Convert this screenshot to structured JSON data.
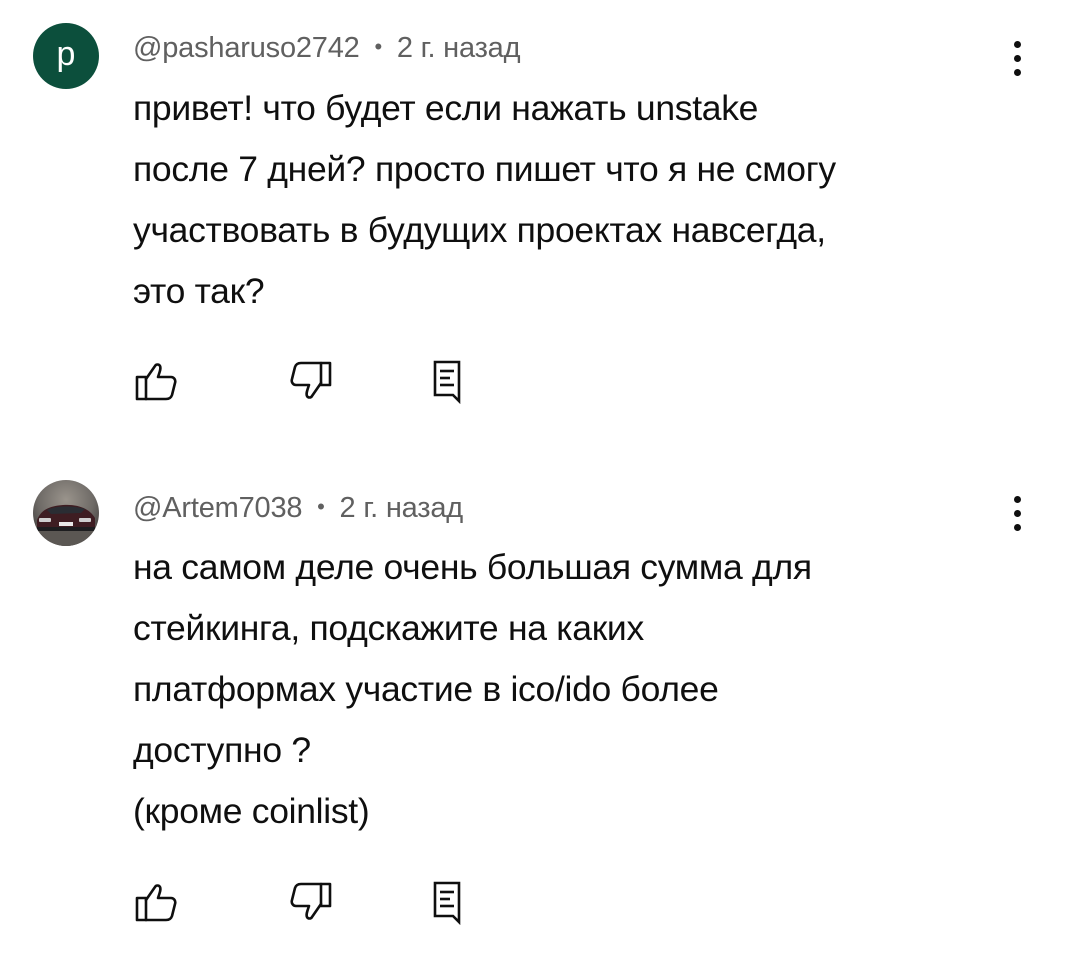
{
  "comments": [
    {
      "avatar_letter": "p",
      "avatar_color": "#0c4f3c",
      "author": "@pasharuso2742",
      "separator": "•",
      "time": "2 г. назад",
      "text": "привет! что будет если нажать unstake\nпосле 7 дней? просто пишет что я не смогу\nучаствовать  в будущих проектах навсегда,\nэто так?",
      "icons": {
        "like": "thumbs-up-icon",
        "dislike": "thumbs-down-icon",
        "reply": "reply-icon",
        "menu": "more-vert-icon"
      }
    },
    {
      "avatar_image": "car-photo",
      "author": "@Artem7038",
      "separator": "•",
      "time": "2 г. назад",
      "text": "на самом деле очень большая сумма для\nстейкинга, подскажите на каких\nплатформах участие в ico/ido более\nдоступно ?\n(кроме coinlist)",
      "icons": {
        "like": "thumbs-up-icon",
        "dislike": "thumbs-down-icon",
        "reply": "reply-icon",
        "menu": "more-vert-icon"
      }
    }
  ]
}
